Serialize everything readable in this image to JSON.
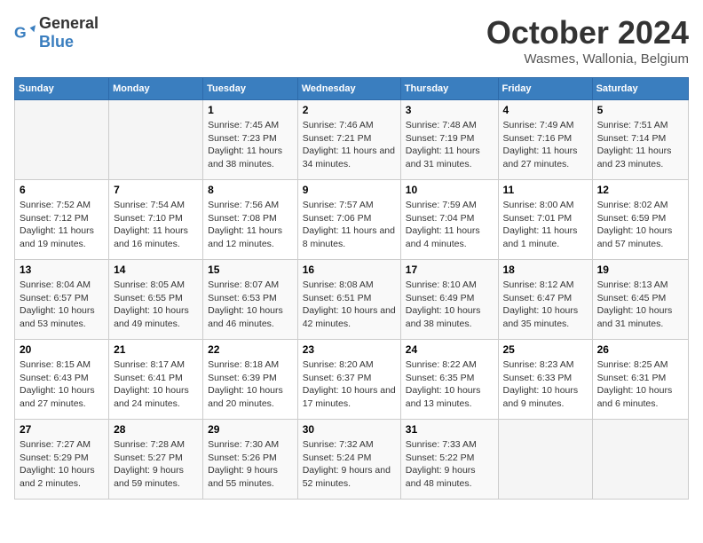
{
  "header": {
    "logo_general": "General",
    "logo_blue": "Blue",
    "title": "October 2024",
    "subtitle": "Wasmes, Wallonia, Belgium"
  },
  "days_of_week": [
    "Sunday",
    "Monday",
    "Tuesday",
    "Wednesday",
    "Thursday",
    "Friday",
    "Saturday"
  ],
  "weeks": [
    [
      {
        "day": "",
        "info": ""
      },
      {
        "day": "",
        "info": ""
      },
      {
        "day": "1",
        "info": "Sunrise: 7:45 AM\nSunset: 7:23 PM\nDaylight: 11 hours and 38 minutes."
      },
      {
        "day": "2",
        "info": "Sunrise: 7:46 AM\nSunset: 7:21 PM\nDaylight: 11 hours and 34 minutes."
      },
      {
        "day": "3",
        "info": "Sunrise: 7:48 AM\nSunset: 7:19 PM\nDaylight: 11 hours and 31 minutes."
      },
      {
        "day": "4",
        "info": "Sunrise: 7:49 AM\nSunset: 7:16 PM\nDaylight: 11 hours and 27 minutes."
      },
      {
        "day": "5",
        "info": "Sunrise: 7:51 AM\nSunset: 7:14 PM\nDaylight: 11 hours and 23 minutes."
      }
    ],
    [
      {
        "day": "6",
        "info": "Sunrise: 7:52 AM\nSunset: 7:12 PM\nDaylight: 11 hours and 19 minutes."
      },
      {
        "day": "7",
        "info": "Sunrise: 7:54 AM\nSunset: 7:10 PM\nDaylight: 11 hours and 16 minutes."
      },
      {
        "day": "8",
        "info": "Sunrise: 7:56 AM\nSunset: 7:08 PM\nDaylight: 11 hours and 12 minutes."
      },
      {
        "day": "9",
        "info": "Sunrise: 7:57 AM\nSunset: 7:06 PM\nDaylight: 11 hours and 8 minutes."
      },
      {
        "day": "10",
        "info": "Sunrise: 7:59 AM\nSunset: 7:04 PM\nDaylight: 11 hours and 4 minutes."
      },
      {
        "day": "11",
        "info": "Sunrise: 8:00 AM\nSunset: 7:01 PM\nDaylight: 11 hours and 1 minute."
      },
      {
        "day": "12",
        "info": "Sunrise: 8:02 AM\nSunset: 6:59 PM\nDaylight: 10 hours and 57 minutes."
      }
    ],
    [
      {
        "day": "13",
        "info": "Sunrise: 8:04 AM\nSunset: 6:57 PM\nDaylight: 10 hours and 53 minutes."
      },
      {
        "day": "14",
        "info": "Sunrise: 8:05 AM\nSunset: 6:55 PM\nDaylight: 10 hours and 49 minutes."
      },
      {
        "day": "15",
        "info": "Sunrise: 8:07 AM\nSunset: 6:53 PM\nDaylight: 10 hours and 46 minutes."
      },
      {
        "day": "16",
        "info": "Sunrise: 8:08 AM\nSunset: 6:51 PM\nDaylight: 10 hours and 42 minutes."
      },
      {
        "day": "17",
        "info": "Sunrise: 8:10 AM\nSunset: 6:49 PM\nDaylight: 10 hours and 38 minutes."
      },
      {
        "day": "18",
        "info": "Sunrise: 8:12 AM\nSunset: 6:47 PM\nDaylight: 10 hours and 35 minutes."
      },
      {
        "day": "19",
        "info": "Sunrise: 8:13 AM\nSunset: 6:45 PM\nDaylight: 10 hours and 31 minutes."
      }
    ],
    [
      {
        "day": "20",
        "info": "Sunrise: 8:15 AM\nSunset: 6:43 PM\nDaylight: 10 hours and 27 minutes."
      },
      {
        "day": "21",
        "info": "Sunrise: 8:17 AM\nSunset: 6:41 PM\nDaylight: 10 hours and 24 minutes."
      },
      {
        "day": "22",
        "info": "Sunrise: 8:18 AM\nSunset: 6:39 PM\nDaylight: 10 hours and 20 minutes."
      },
      {
        "day": "23",
        "info": "Sunrise: 8:20 AM\nSunset: 6:37 PM\nDaylight: 10 hours and 17 minutes."
      },
      {
        "day": "24",
        "info": "Sunrise: 8:22 AM\nSunset: 6:35 PM\nDaylight: 10 hours and 13 minutes."
      },
      {
        "day": "25",
        "info": "Sunrise: 8:23 AM\nSunset: 6:33 PM\nDaylight: 10 hours and 9 minutes."
      },
      {
        "day": "26",
        "info": "Sunrise: 8:25 AM\nSunset: 6:31 PM\nDaylight: 10 hours and 6 minutes."
      }
    ],
    [
      {
        "day": "27",
        "info": "Sunrise: 7:27 AM\nSunset: 5:29 PM\nDaylight: 10 hours and 2 minutes."
      },
      {
        "day": "28",
        "info": "Sunrise: 7:28 AM\nSunset: 5:27 PM\nDaylight: 9 hours and 59 minutes."
      },
      {
        "day": "29",
        "info": "Sunrise: 7:30 AM\nSunset: 5:26 PM\nDaylight: 9 hours and 55 minutes."
      },
      {
        "day": "30",
        "info": "Sunrise: 7:32 AM\nSunset: 5:24 PM\nDaylight: 9 hours and 52 minutes."
      },
      {
        "day": "31",
        "info": "Sunrise: 7:33 AM\nSunset: 5:22 PM\nDaylight: 9 hours and 48 minutes."
      },
      {
        "day": "",
        "info": ""
      },
      {
        "day": "",
        "info": ""
      }
    ]
  ]
}
